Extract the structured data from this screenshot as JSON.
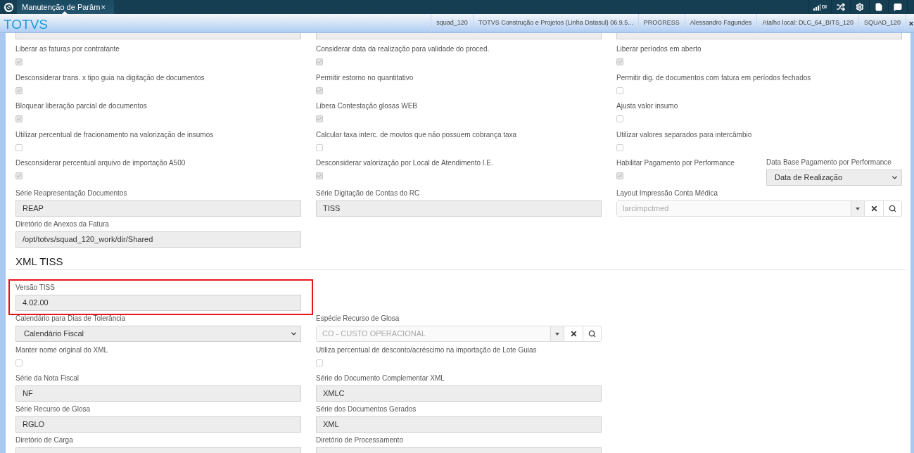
{
  "topbar": {
    "tab": {
      "title": "Manutenção de Parâm",
      "close": "×",
      "selected": true
    },
    "indicator": "DI"
  },
  "header": {
    "brand": "TOTVS",
    "info": [
      "squad_120",
      "TOTVS Construção e Projetos (Linha Datasul) 06.9.5...",
      "PROGRESS",
      "Alessandro Fagundes",
      "Atalho local: DLC_64_BITS_120",
      "SQUAD_120"
    ]
  },
  "sections": [
    {
      "rows": [
        [
          {
            "kind": "partial"
          },
          {
            "kind": "partial"
          },
          {
            "kind": "partial"
          }
        ],
        [
          {
            "kind": "checkbox",
            "label": "Liberar as faturas por contratante",
            "checked": true
          },
          {
            "kind": "checkbox",
            "label": "Considerar data da realização para validade do proced.",
            "checked": true
          },
          {
            "kind": "checkbox",
            "label": "Liberar períodos em aberto",
            "checked": true
          }
        ],
        [
          {
            "kind": "checkbox",
            "label": "Desconsiderar trans. x tipo guia na digitação de documentos",
            "checked": true
          },
          {
            "kind": "checkbox",
            "label": "Permitir estorno no quantitativo",
            "checked": true
          },
          {
            "kind": "checkbox",
            "label": "Permitir dig. de documentos com fatura em períodos fechados",
            "checked": false
          }
        ],
        [
          {
            "kind": "checkbox",
            "label": "Bloquear liberação parcial de documentos",
            "checked": true
          },
          {
            "kind": "checkbox",
            "label": "Libera Contestação glosas WEB",
            "checked": true
          },
          {
            "kind": "checkbox",
            "label": "Ajusta valor insumo",
            "checked": false
          }
        ],
        [
          {
            "kind": "checkbox",
            "label": "Utilizar percentual de fracionamento na valorização de insumos",
            "checked": false
          },
          {
            "kind": "checkbox",
            "label": "Calcular taxa interc. de movtos que não possuem cobrança taxa",
            "checked": false
          },
          {
            "kind": "checkbox",
            "label": "Utilizar valores separados para intercâmbio",
            "checked": false
          }
        ],
        [
          {
            "kind": "checkbox",
            "label": "Desconsiderar percentual arquivo de importação A500",
            "checked": true
          },
          {
            "kind": "checkbox",
            "label": "Desconsiderar valorização por Local de Atendimento I.E.",
            "checked": true
          },
          {
            "kind": "group",
            "items": [
              {
                "kind": "checkbox",
                "label": "Habilitar Pagamento por Performance",
                "checked": true
              },
              {
                "kind": "select",
                "label": "Data Base Pagamento por Performance",
                "value": "Data de Realização"
              }
            ]
          }
        ],
        [
          {
            "kind": "text",
            "label": "Série Reapresentação Documentos",
            "value": "REAP"
          },
          {
            "kind": "text",
            "label": "Série Digitação de Contas do RC",
            "value": "TISS"
          },
          {
            "kind": "lookup",
            "label": "Layout Impressão Conta Médica",
            "placeholder": "larcimpctmed"
          }
        ],
        [
          {
            "kind": "text",
            "label": "Diretório de Anexos da Fatura",
            "value": "/opt/totvs/squad_120_work/dir/Shared"
          },
          null,
          null
        ]
      ]
    },
    {
      "heading": "XML TISS",
      "rows": [
        [
          {
            "kind": "text",
            "label": "Versão TISS",
            "value": "4.02.00",
            "highlighted": true
          },
          null,
          null
        ],
        [
          {
            "kind": "select",
            "label": "Calendário para Dias de Tolerância",
            "value": "Calendário Fiscal"
          },
          {
            "kind": "lookup",
            "label": "Espécie Recurso de Glosa",
            "placeholder": "CO - CUSTO OPERACIONAL"
          },
          null
        ],
        [
          {
            "kind": "checkbox",
            "label": "Manter nome original do XML",
            "checked": false
          },
          {
            "kind": "checkbox",
            "label": "Utiliza percentual de desconto/acréscimo na importação de Lote Guias",
            "checked": false
          },
          null
        ],
        [
          {
            "kind": "text",
            "label": "Série da Nota Fiscal",
            "value": "NF"
          },
          {
            "kind": "text",
            "label": "Série do Documento Complementar XML",
            "value": "XMLC"
          },
          null
        ],
        [
          {
            "kind": "text",
            "label": "Série Recurso de Glosa",
            "value": "RGLO"
          },
          {
            "kind": "text",
            "label": "Série dos Documentos Gerados",
            "value": "XML"
          },
          null
        ],
        [
          {
            "kind": "text",
            "label": "Diretório de Carga"
          },
          {
            "kind": "text",
            "label": "Diretório de Processamento"
          },
          null
        ]
      ]
    }
  ]
}
